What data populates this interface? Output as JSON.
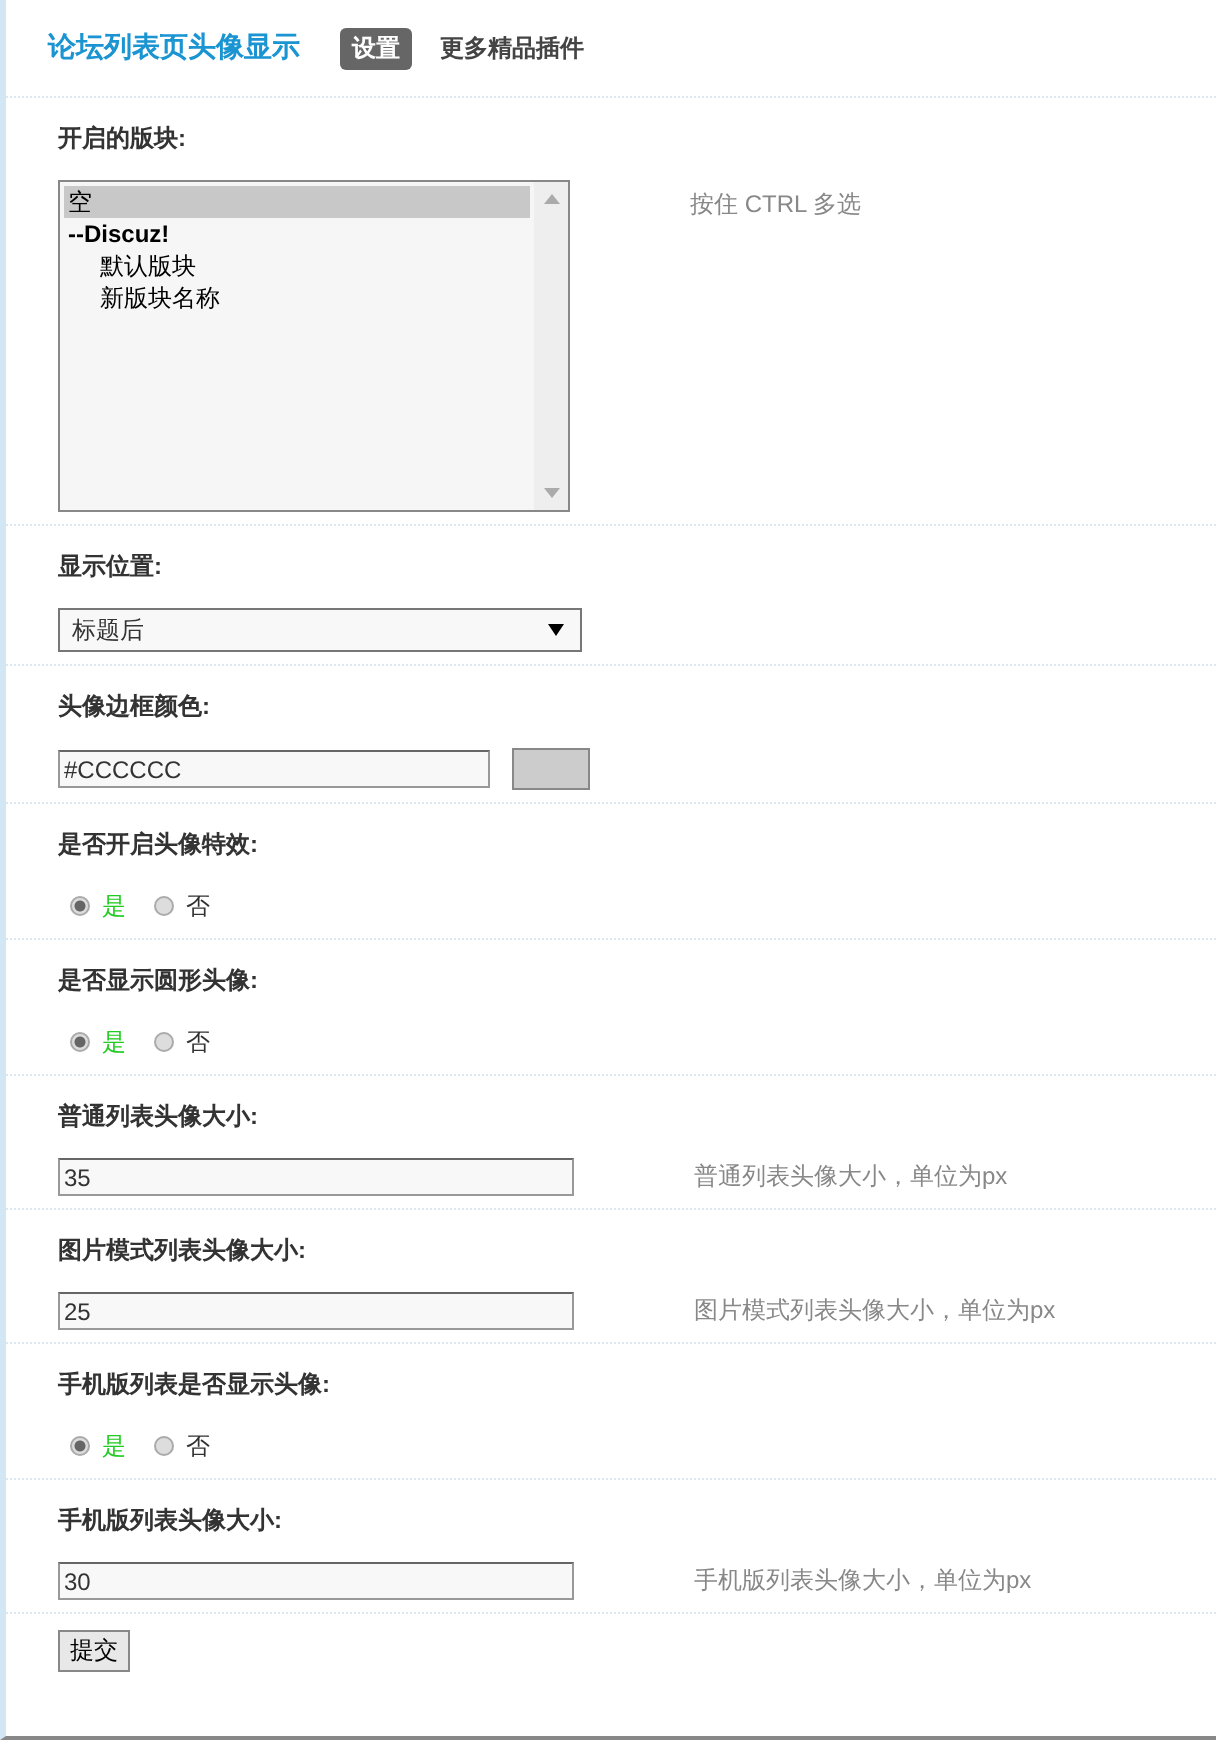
{
  "header": {
    "title": "论坛列表页头像显示",
    "tabs": [
      {
        "label": "设置",
        "selected": true
      },
      {
        "label": "更多精品插件",
        "selected": false
      }
    ]
  },
  "fields": [
    {
      "kind": "multiselect",
      "label": "开启的版块:",
      "hint": "按住 CTRL 多选",
      "options": [
        {
          "label": "空",
          "selected": true
        },
        {
          "label": "--Discuz!",
          "selected": false,
          "children": [
            {
              "label": "默认版块",
              "selected": false
            },
            {
              "label": "新版块名称",
              "selected": false
            }
          ]
        }
      ]
    },
    {
      "kind": "select",
      "label": "显示位置:",
      "value": "标题后"
    },
    {
      "kind": "color",
      "label": "头像边框颜色:",
      "value": "#CCCCCC"
    },
    {
      "kind": "radio",
      "label": "是否开启头像特效:",
      "options": [
        {
          "label": "是",
          "selected": true
        },
        {
          "label": "否",
          "selected": false
        }
      ]
    },
    {
      "kind": "radio",
      "label": "是否显示圆形头像:",
      "options": [
        {
          "label": "是",
          "selected": true
        },
        {
          "label": "否",
          "selected": false
        }
      ]
    },
    {
      "kind": "text",
      "label": "普通列表头像大小:",
      "value": "35",
      "hint": "普通列表头像大小，单位为px"
    },
    {
      "kind": "text",
      "label": "图片模式列表头像大小:",
      "value": "25",
      "hint": "图片模式列表头像大小，单位为px"
    },
    {
      "kind": "radio",
      "label": "手机版列表是否显示头像:",
      "options": [
        {
          "label": "是",
          "selected": true
        },
        {
          "label": "否",
          "selected": false
        }
      ]
    },
    {
      "kind": "text",
      "label": "手机版列表头像大小:",
      "value": "30",
      "hint": "手机版列表头像大小，单位为px"
    }
  ],
  "submit": "提交"
}
